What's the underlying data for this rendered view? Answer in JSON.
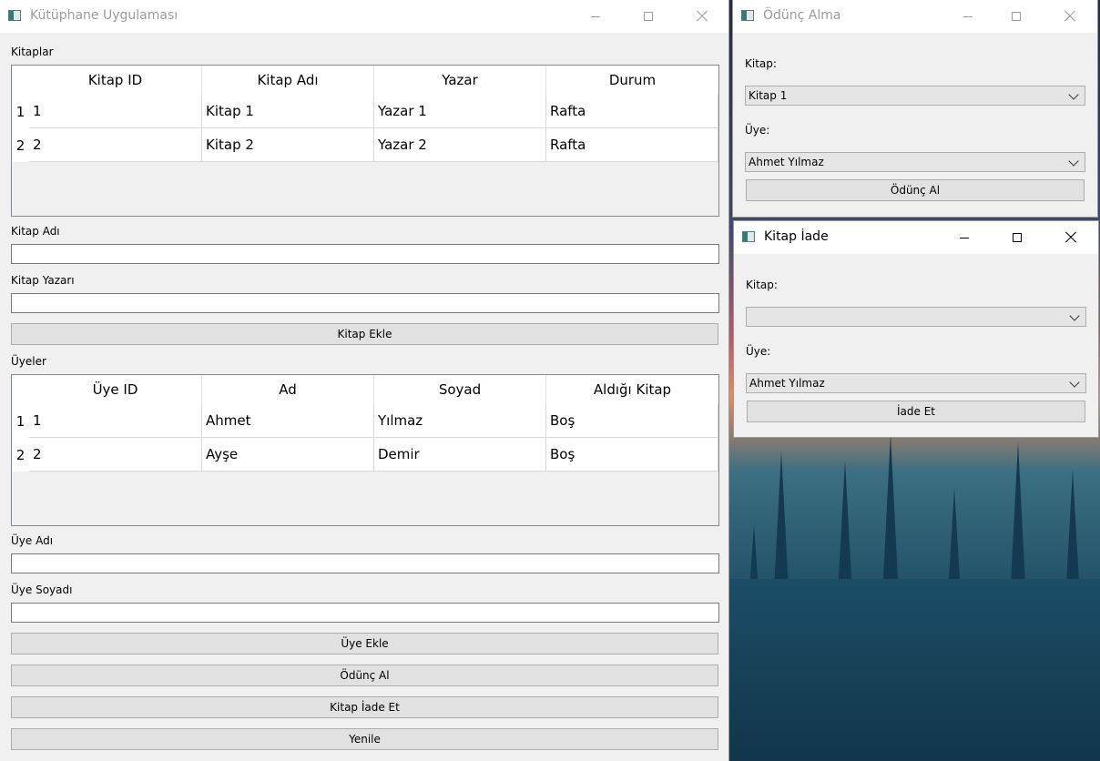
{
  "main_window": {
    "title": "Kütüphane Uygulaması",
    "books_label": "Kitaplar",
    "books_table": {
      "headers": [
        "Kitap ID",
        "Kitap Adı",
        "Yazar",
        "Durum"
      ],
      "row_numbers": [
        "1",
        "2"
      ],
      "rows": [
        [
          "1",
          "Kitap 1",
          "Yazar 1",
          "Rafta"
        ],
        [
          "2",
          "Kitap 2",
          "Yazar 2",
          "Rafta"
        ]
      ]
    },
    "book_name_label": "Kitap Adı",
    "book_name_value": "",
    "book_author_label": "Kitap Yazarı",
    "book_author_value": "",
    "add_book_button": "Kitap Ekle",
    "members_label": "Üyeler",
    "members_table": {
      "headers": [
        "Üye ID",
        "Ad",
        "Soyad",
        "Aldığı Kitap"
      ],
      "row_numbers": [
        "1",
        "2"
      ],
      "rows": [
        [
          "1",
          "Ahmet",
          "Yılmaz",
          "Boş"
        ],
        [
          "2",
          "Ayşe",
          "Demir",
          "Boş"
        ]
      ]
    },
    "member_name_label": "Üye Adı",
    "member_name_value": "",
    "member_surname_label": "Üye Soyadı",
    "member_surname_value": "",
    "add_member_button": "Üye Ekle",
    "borrow_button": "Ödünç Al",
    "return_button": "Kitap İade Et",
    "refresh_button": "Yenile"
  },
  "borrow_window": {
    "title": "Ödünç Alma",
    "book_label": "Kitap:",
    "book_selected": "Kitap 1",
    "member_label": "Üye:",
    "member_selected": "Ahmet Yılmaz",
    "submit_button": "Ödünç Al"
  },
  "return_window": {
    "title": "Kitap İade",
    "book_label": "Kitap:",
    "book_selected": "",
    "member_label": "Üye:",
    "member_selected": "Ahmet Yılmaz",
    "submit_button": "İade Et"
  }
}
